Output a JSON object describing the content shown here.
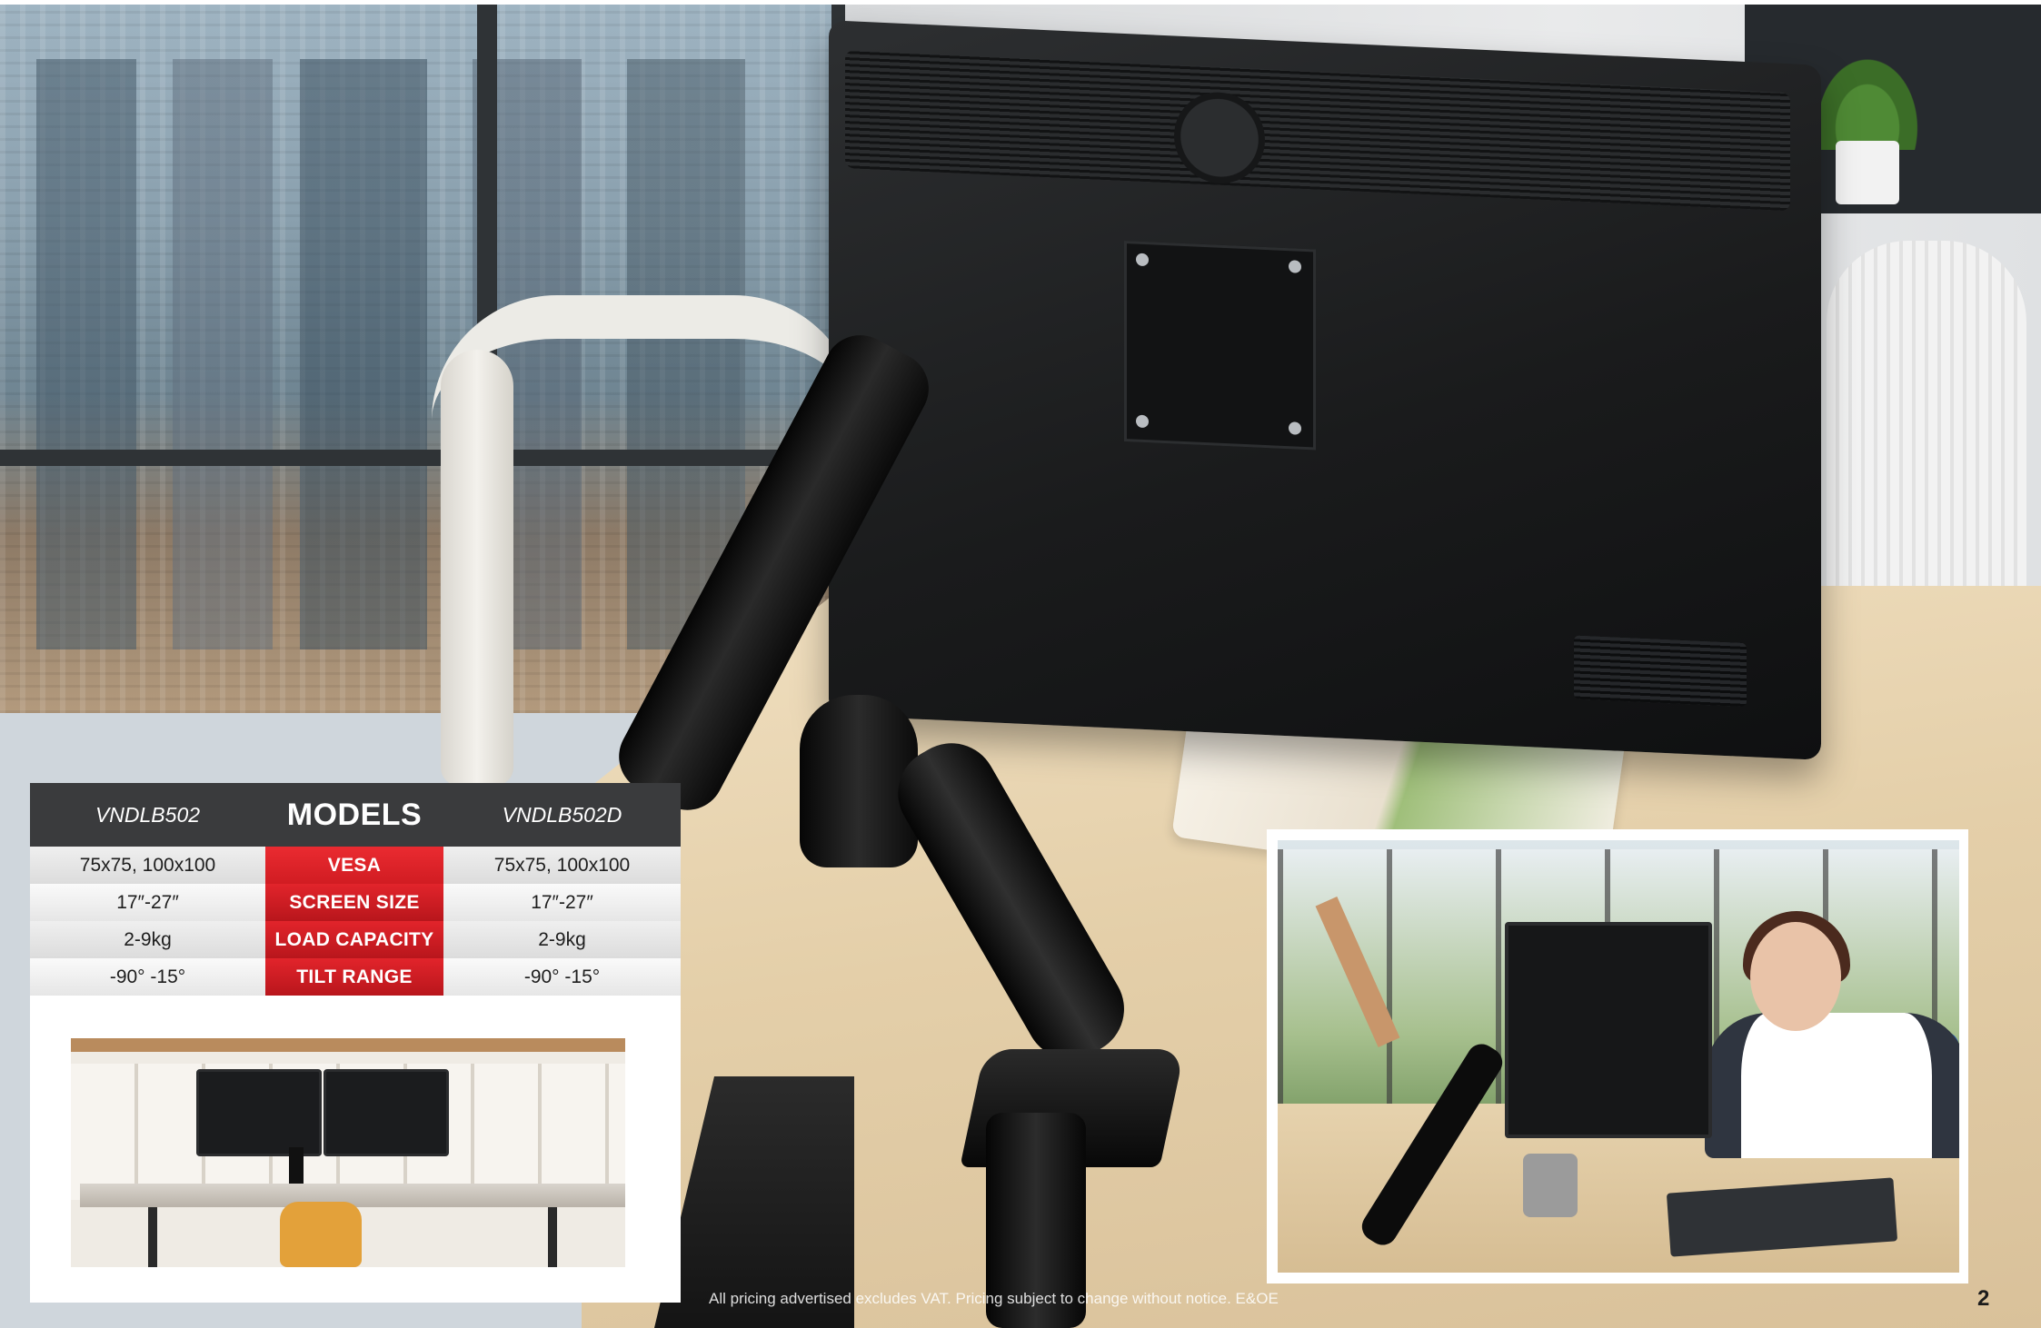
{
  "spec_table": {
    "models": [
      "VNDLB502",
      "VNDLB502D"
    ],
    "heading": "MODELS",
    "rows": [
      {
        "left": "75x75, 100x100",
        "label": "VESA",
        "right": "75x75, 100x100"
      },
      {
        "left": "17″-27″",
        "label": "SCREEN SIZE",
        "right": "17″-27″"
      },
      {
        "left": "2-9kg",
        "label": "LOAD CAPACITY",
        "right": "2-9kg"
      },
      {
        "left": "-90° -15°",
        "label": "TILT RANGE",
        "right": "-90° -15°"
      }
    ]
  },
  "footer": {
    "disclaimer": "All pricing advertised excludes VAT. Pricing subject to change without notice. E&OE",
    "page_number": "2"
  },
  "colors": {
    "accent_red": "#d11c22",
    "header_dark": "#3a3b3d"
  }
}
